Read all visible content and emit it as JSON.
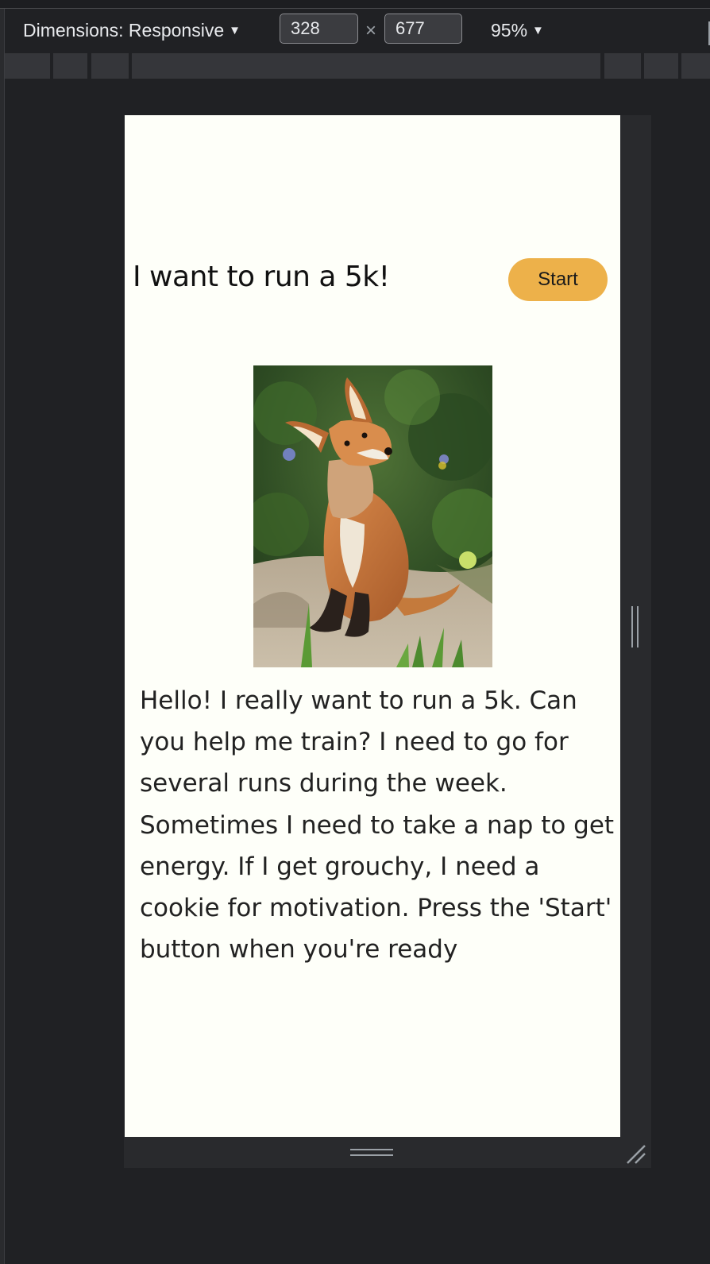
{
  "toolbar": {
    "dimensions_label": "Dimensions: Responsive",
    "width_value": "328",
    "height_value": "677",
    "times_symbol": "×",
    "zoom_label": "95%"
  },
  "page": {
    "title": "I want to run a 5k!",
    "start_label": "Start",
    "image_subject": "fox",
    "intro_text": "Hello! I really want to run a 5k. Can you help me train? I need to go for several runs during the week. Sometimes I need to take a nap to get energy. If I get grouchy, I need a cookie for motivation. Press the 'Start' button when you're ready"
  },
  "colors": {
    "devtools_background": "#202124",
    "viewport_background": "#fefff9",
    "start_button": "#edb14a"
  },
  "icons": {
    "dropdown": "chevron-down-icon",
    "resize_corner": "resize-corner-icon"
  }
}
